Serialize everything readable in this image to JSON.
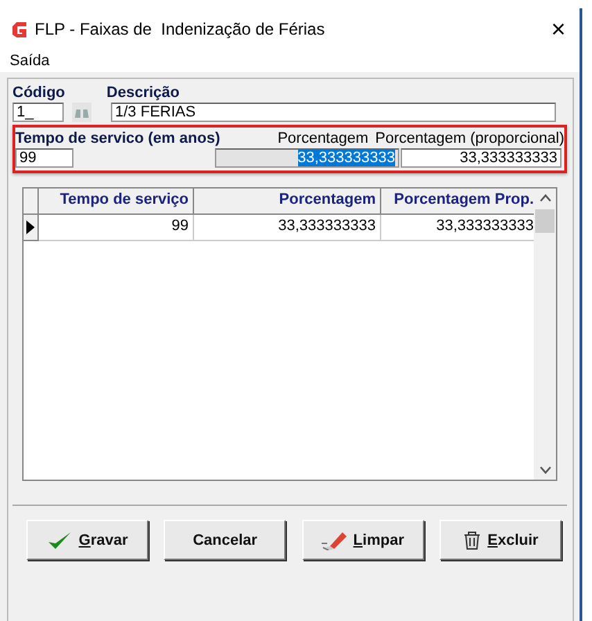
{
  "window": {
    "title": "FLP - Faixas de  Indenização de Férias",
    "close": "×"
  },
  "menu": [
    "Saída"
  ],
  "codigo": {
    "label": "Código",
    "value": "1_"
  },
  "descricao": {
    "label": "Descrição",
    "value": "1/3 FERIAS"
  },
  "tempo": {
    "label": "Tempo de servico (em anos)",
    "value": "99"
  },
  "porcentagem": {
    "label": "Porcentagem",
    "value": "33,333333333",
    "selected": true
  },
  "proporcional": {
    "label": "Porcentagem (proporcional)",
    "value": "33,333333333"
  },
  "table": {
    "columns": [
      "Tempo de serviço",
      "Porcentagem",
      "Porcentagem Prop."
    ],
    "rows": [
      {
        "cells": [
          "99",
          "33,333333333",
          "33,333333333"
        ],
        "selected": true
      }
    ]
  },
  "buttons": [
    {
      "kind": "save",
      "accel": "G",
      "rest": "ravar"
    },
    {
      "kind": "cancel",
      "rest": "Cancelar"
    },
    {
      "kind": "clear",
      "accel": "L",
      "rest": "impar"
    },
    {
      "kind": "delete",
      "accel": "E",
      "rest": "xcluir"
    }
  ]
}
